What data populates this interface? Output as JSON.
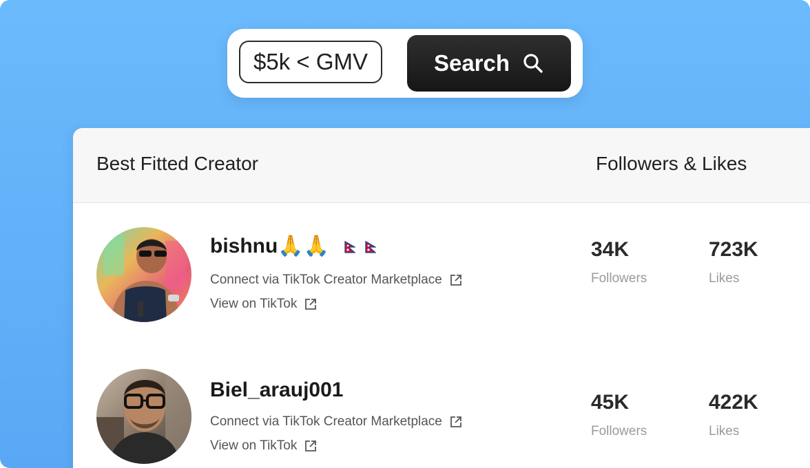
{
  "search": {
    "filter_label": "$5k < GMV",
    "button_label": "Search",
    "icon": "search-icon"
  },
  "table": {
    "columns": [
      "Best Fitted Creator",
      "Followers & Likes"
    ],
    "rows": [
      {
        "name": "bishnu🙏🙏",
        "flags": [
          "nepal-flag-icon",
          "nepal-flag-icon"
        ],
        "connect_link": "Connect via TikTok Creator Marketplace",
        "view_link": "View on TikTok",
        "followers": "34K",
        "followers_label": "Followers",
        "likes": "723K",
        "likes_label": "Likes"
      },
      {
        "name": "Biel_arauj001",
        "connect_link": "Connect via TikTok Creator Marketplace",
        "view_link": "View on TikTok",
        "followers": "45K",
        "followers_label": "Followers",
        "likes": "422K",
        "likes_label": "Likes"
      }
    ]
  },
  "colors": {
    "background": "#5aa8f5",
    "button": "#1f1f1f",
    "card_header": "#f7f7f7"
  }
}
